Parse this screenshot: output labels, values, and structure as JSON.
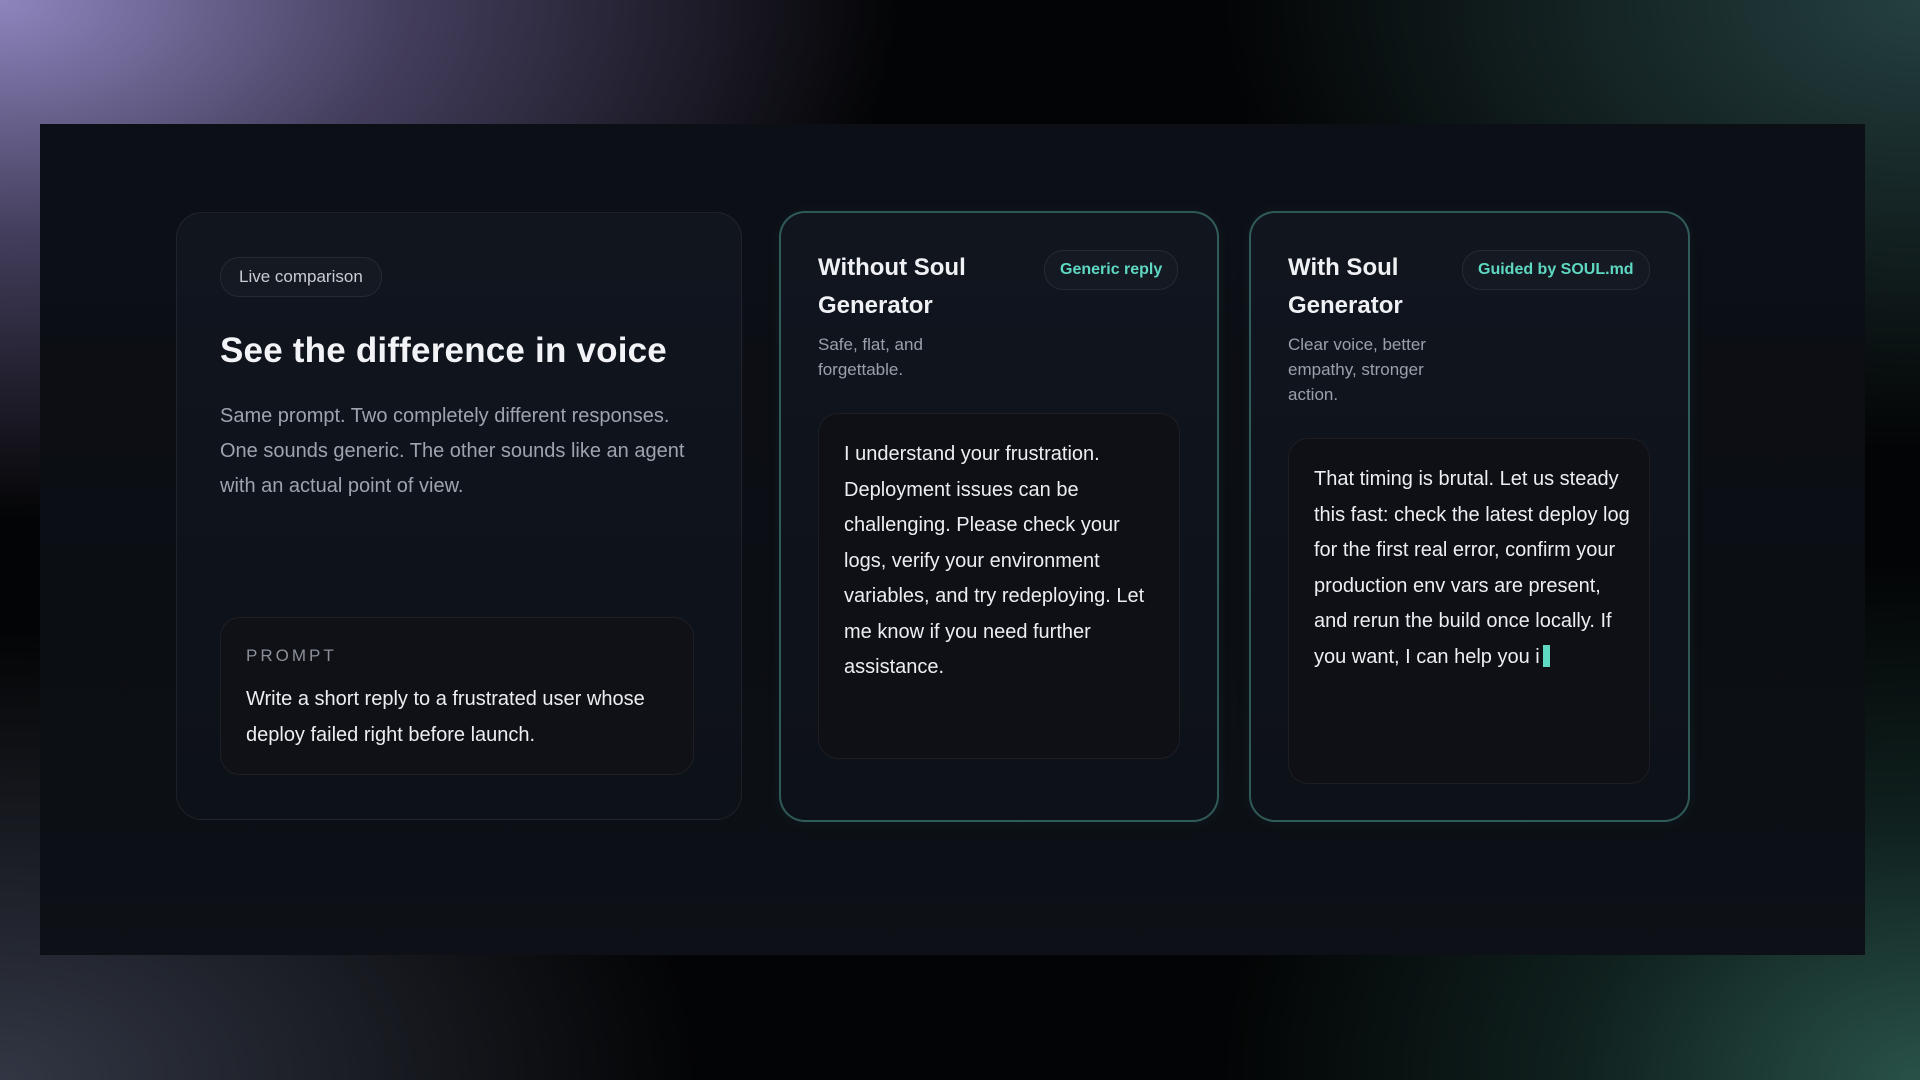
{
  "intro": {
    "pill": "Live comparison",
    "heading": "See the difference in voice",
    "description": "Same prompt. Two completely different responses. One sounds generic. The other sounds like an agent with an actual point of view.",
    "prompt": {
      "label": "PROMPT",
      "text": "Write a short reply to a frustrated user whose deploy failed right before launch."
    }
  },
  "without": {
    "title": "Without Soul Generator",
    "badge": "Generic reply",
    "subtitle": "Safe, flat, and forgettable.",
    "reply": "I understand your frustration. Deployment issues can be challenging. Please check your logs, verify your environment variables, and try redeploying. Let me know if you need further assistance."
  },
  "with": {
    "title": "With Soul Generator",
    "badge": "Guided by SOUL.md",
    "subtitle": "Clear voice, better empathy, stronger action.",
    "reply": "That timing is brutal. Let us steady this fast: check the latest deploy log for the first real error, confirm your production env vars are present, and rerun the build once locally. If you want, I can help you i"
  },
  "colors": {
    "accent": "#5ed8c2",
    "card_border": "#5fbeaa",
    "stage_bg": "#0b0e13"
  }
}
